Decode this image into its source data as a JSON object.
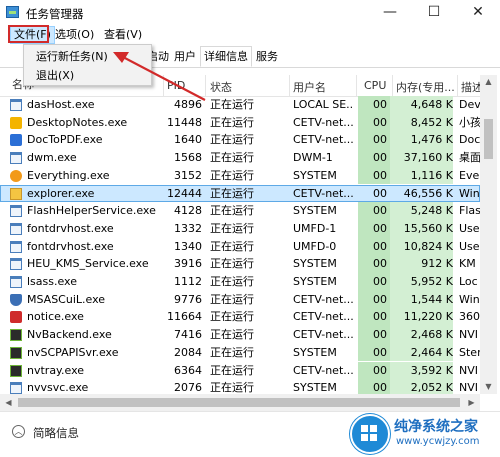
{
  "window": {
    "title": "任务管理器",
    "controls": {
      "minimize": "—",
      "maximize": "☐",
      "close": "✕"
    }
  },
  "menubar": {
    "items": [
      "文件(F)",
      "选项(O)",
      "查看(V)"
    ]
  },
  "file_menu": {
    "items": [
      "运行新任务(N)",
      "退出(X)"
    ]
  },
  "tabs": {
    "visible": [
      "启动",
      "用户",
      "详细信息",
      "服务"
    ],
    "selected": "详细信息"
  },
  "table": {
    "columns": [
      "名称",
      "PID",
      "状态",
      "用户名",
      "CPU",
      "内存(专用...",
      "描述"
    ],
    "rows": [
      {
        "icon": "window-icon",
        "name": "dasHost.exe",
        "pid": "4896",
        "status": "正在运行",
        "user": "LOCAL SE...",
        "cpu": "00",
        "mem": "4,648 K",
        "desc": "Dev"
      },
      {
        "icon": "notes-app-icon",
        "name": "DesktopNotes.exe",
        "pid": "11448",
        "status": "正在运行",
        "user": "CETV-net...",
        "cpu": "00",
        "mem": "8,452 K",
        "desc": "小孩"
      },
      {
        "icon": "pdf-icon",
        "name": "DocToPDF.exe",
        "pid": "1640",
        "status": "正在运行",
        "user": "CETV-net...",
        "cpu": "00",
        "mem": "1,476 K",
        "desc": "Doc"
      },
      {
        "icon": "window-icon",
        "name": "dwm.exe",
        "pid": "1568",
        "status": "正在运行",
        "user": "DWM-1",
        "cpu": "00",
        "mem": "37,160 K",
        "desc": "桌面"
      },
      {
        "icon": "search-app-icon",
        "name": "Everything.exe",
        "pid": "3152",
        "status": "正在运行",
        "user": "SYSTEM",
        "cpu": "00",
        "mem": "1,116 K",
        "desc": "Eve"
      },
      {
        "icon": "folder-icon",
        "name": "explorer.exe",
        "pid": "12444",
        "status": "正在运行",
        "user": "CETV-net...",
        "cpu": "00",
        "mem": "46,556 K",
        "desc": "Win"
      },
      {
        "icon": "window-icon",
        "name": "FlashHelperService.exe",
        "pid": "4128",
        "status": "正在运行",
        "user": "SYSTEM",
        "cpu": "00",
        "mem": "5,248 K",
        "desc": "Flas"
      },
      {
        "icon": "window-icon",
        "name": "fontdrvhost.exe",
        "pid": "1332",
        "status": "正在运行",
        "user": "UMFD-1",
        "cpu": "00",
        "mem": "15,560 K",
        "desc": "Use"
      },
      {
        "icon": "window-icon",
        "name": "fontdrvhost.exe",
        "pid": "1340",
        "status": "正在运行",
        "user": "UMFD-0",
        "cpu": "00",
        "mem": "10,824 K",
        "desc": "Use"
      },
      {
        "icon": "window-icon",
        "name": "HEU_KMS_Service.exe",
        "pid": "3916",
        "status": "正在运行",
        "user": "SYSTEM",
        "cpu": "00",
        "mem": "912 K",
        "desc": "KM"
      },
      {
        "icon": "window-icon",
        "name": "lsass.exe",
        "pid": "1112",
        "status": "正在运行",
        "user": "SYSTEM",
        "cpu": "00",
        "mem": "5,952 K",
        "desc": "Loc"
      },
      {
        "icon": "shield-icon",
        "name": "MSASCuiL.exe",
        "pid": "9776",
        "status": "正在运行",
        "user": "CETV-net...",
        "cpu": "00",
        "mem": "1,544 K",
        "desc": "Win"
      },
      {
        "icon": "notice-icon",
        "name": "notice.exe",
        "pid": "11664",
        "status": "正在运行",
        "user": "CETV-net...",
        "cpu": "00",
        "mem": "11,220 K",
        "desc": "360"
      },
      {
        "icon": "nvidia-icon",
        "name": "NvBackend.exe",
        "pid": "7416",
        "status": "正在运行",
        "user": "CETV-net...",
        "cpu": "00",
        "mem": "2,468 K",
        "desc": "NVI"
      },
      {
        "icon": "nvidia-icon",
        "name": "nvSCPAPISvr.exe",
        "pid": "2084",
        "status": "正在运行",
        "user": "SYSTEM",
        "cpu": "00",
        "mem": "2,464 K",
        "desc": "Ster"
      },
      {
        "icon": "nvidia-icon",
        "name": "nvtray.exe",
        "pid": "6364",
        "status": "正在运行",
        "user": "CETV-net...",
        "cpu": "00",
        "mem": "3,592 K",
        "desc": "NVI"
      },
      {
        "icon": "window-icon",
        "name": "nvvsvc.exe",
        "pid": "2076",
        "status": "正在运行",
        "user": "SYSTEM",
        "cpu": "00",
        "mem": "2,052 K",
        "desc": "NVI"
      }
    ],
    "selected_row": 5
  },
  "footer": {
    "label": "简略信息",
    "icon": "chevron-up-icon"
  },
  "watermark": {
    "line1": "纯净系统之家",
    "line2": "www.ycwjzy.com"
  },
  "colors": {
    "selection": "#cce8ff",
    "cpu_column": "#bfe6bf",
    "memory_column": "#d3efd3",
    "highlight_box": "#d22a2a",
    "annotation_arrow": "#d22a2a"
  }
}
